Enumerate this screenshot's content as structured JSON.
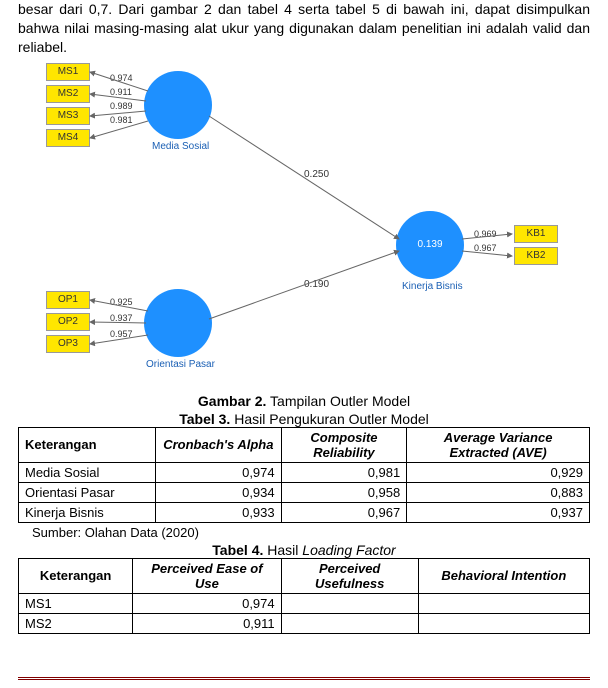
{
  "intro": "besar dari 0,7. Dari gambar 2 dan tabel 4 serta tabel 5 di bawah ini, dapat disimpulkan bahwa nilai masing-masing alat ukur yang digunakan dalam penelitian ini adalah valid dan reliabel.",
  "diagram": {
    "ms": {
      "label": "Media Sosial",
      "indicators": [
        "MS1",
        "MS2",
        "MS3",
        "MS4"
      ],
      "loadings": [
        "0.974",
        "0.911",
        "0.989",
        "0.981"
      ]
    },
    "op": {
      "label": "Orientasi Pasar",
      "indicators": [
        "OP1",
        "OP2",
        "OP3"
      ],
      "loadings": [
        "0.925",
        "0.937",
        "0.957"
      ]
    },
    "kb": {
      "label": "Kinerja Bisnis",
      "value": "0.139",
      "indicators": [
        "KB1",
        "KB2"
      ],
      "loadings": [
        "0.969",
        "0.967"
      ]
    },
    "paths": {
      "ms_kb": "0.250",
      "op_kb": "0.190"
    }
  },
  "captions": {
    "gambar2": "Gambar 2. Tampilan Outler Model",
    "tabel3": "Tabel 3. Hasil Pengukuran Outler Model",
    "tabel4": "Tabel 4. Hasil Loading Factor"
  },
  "table3": {
    "headers": [
      "Keterangan",
      "Cronbach's Alpha",
      "Composite Reliability",
      "Average Variance Extracted (AVE)"
    ],
    "rows": [
      [
        "Media Sosial",
        "0,974",
        "0,981",
        "0,929"
      ],
      [
        "Orientasi Pasar",
        "0,934",
        "0,958",
        "0,883"
      ],
      [
        "Kinerja Bisnis",
        "0,933",
        "0,967",
        "0,937"
      ]
    ]
  },
  "source": "Sumber: Olahan Data (2020)",
  "table4": {
    "headers": [
      "Keterangan",
      "Perceived Ease of Use",
      "Perceived Usefulness",
      "Behavioral Intention"
    ],
    "rows": [
      [
        "MS1",
        "0,974",
        "",
        ""
      ],
      [
        "MS2",
        "0,911",
        "",
        ""
      ]
    ]
  },
  "chart_data": {
    "type": "diagram",
    "nodes": [
      {
        "id": "MS",
        "label": "Media Sosial",
        "kind": "latent"
      },
      {
        "id": "OP",
        "label": "Orientasi Pasar",
        "kind": "latent"
      },
      {
        "id": "KB",
        "label": "Kinerja Bisnis",
        "kind": "latent",
        "r2": 0.139
      },
      {
        "id": "MS1",
        "kind": "indicator"
      },
      {
        "id": "MS2",
        "kind": "indicator"
      },
      {
        "id": "MS3",
        "kind": "indicator"
      },
      {
        "id": "MS4",
        "kind": "indicator"
      },
      {
        "id": "OP1",
        "kind": "indicator"
      },
      {
        "id": "OP2",
        "kind": "indicator"
      },
      {
        "id": "OP3",
        "kind": "indicator"
      },
      {
        "id": "KB1",
        "kind": "indicator"
      },
      {
        "id": "KB2",
        "kind": "indicator"
      }
    ],
    "edges": [
      {
        "from": "MS",
        "to": "KB",
        "weight": 0.25
      },
      {
        "from": "OP",
        "to": "KB",
        "weight": 0.19
      },
      {
        "from": "MS",
        "to": "MS1",
        "weight": 0.974
      },
      {
        "from": "MS",
        "to": "MS2",
        "weight": 0.911
      },
      {
        "from": "MS",
        "to": "MS3",
        "weight": 0.989
      },
      {
        "from": "MS",
        "to": "MS4",
        "weight": 0.981
      },
      {
        "from": "OP",
        "to": "OP1",
        "weight": 0.925
      },
      {
        "from": "OP",
        "to": "OP2",
        "weight": 0.937
      },
      {
        "from": "OP",
        "to": "OP3",
        "weight": 0.957
      },
      {
        "from": "KB",
        "to": "KB1",
        "weight": 0.969
      },
      {
        "from": "KB",
        "to": "KB2",
        "weight": 0.967
      }
    ]
  }
}
